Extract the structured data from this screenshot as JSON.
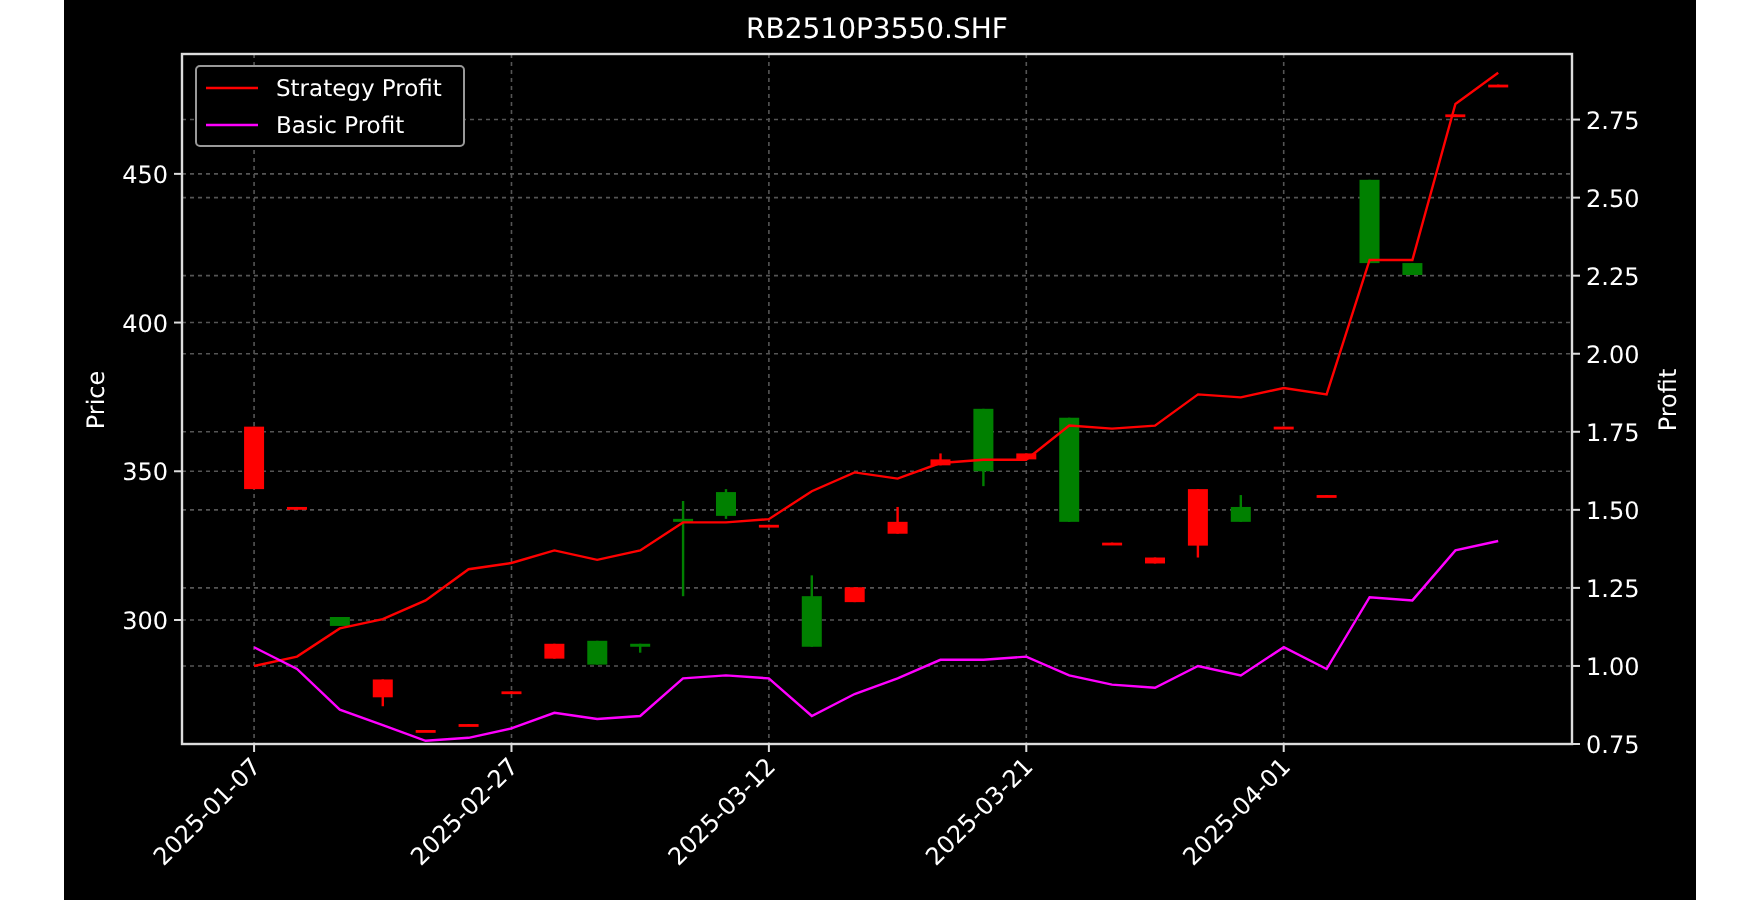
{
  "chart": {
    "chart_data": {
      "type": "line",
      "title": "RB2510P3550.SHF",
      "ylabel": "Price",
      "y2label": "Profit",
      "grid": true,
      "legend": true,
      "categories": [
        "2025-01-07",
        null,
        null,
        null,
        null,
        null,
        "2025-02-27",
        null,
        null,
        null,
        null,
        null,
        "2025-03-12",
        null,
        null,
        null,
        null,
        null,
        "2025-03-21",
        null,
        null,
        null,
        null,
        null,
        "2025-04-01",
        null,
        null,
        null,
        null,
        null
      ],
      "ylim": [
        258.3,
        490.3
      ],
      "y2lim": [
        0.75,
        2.96
      ],
      "yticks": [
        300,
        350,
        400,
        450
      ],
      "y2ticks": [
        {
          "value": 0.75,
          "label": "0.75"
        },
        {
          "value": 1,
          "label": "1.00"
        },
        {
          "value": 1.25,
          "label": "1.25"
        },
        {
          "value": 1.5,
          "label": "1.50"
        },
        {
          "value": 1.75,
          "label": "1.75"
        },
        {
          "value": 2,
          "label": "2.00"
        },
        {
          "value": 2.25,
          "label": "2.25"
        },
        {
          "value": 2.5,
          "label": "2.50"
        },
        {
          "value": 2.75,
          "label": "2.75"
        }
      ],
      "series": [
        {
          "type": "candlestick",
          "ohlc": [
            [
              365,
              365,
              344,
              344
            ],
            [
              338,
              338,
              338,
              338
            ],
            [
              298,
              301,
              298,
              301
            ],
            [
              280,
              280,
              271,
              274
            ],
            [
              263,
              263,
              263,
              263
            ],
            [
              265,
              265,
              265,
              265
            ],
            [
              276,
              276,
              276,
              276
            ],
            [
              292,
              292,
              287,
              287
            ],
            [
              285,
              293,
              285,
              293
            ],
            [
              291,
              292,
              289,
              292
            ],
            [
              333,
              340,
              308,
              334
            ],
            [
              335,
              344,
              334,
              343
            ],
            [
              332,
              332,
              332,
              332
            ],
            [
              291,
              315,
              291,
              308
            ],
            [
              311,
              311,
              306,
              306
            ],
            [
              333,
              338,
              329,
              329
            ],
            [
              354,
              356,
              352,
              352
            ],
            [
              350,
              371,
              345,
              371
            ],
            [
              356,
              356,
              354,
              354
            ],
            [
              333,
              368,
              333,
              368
            ],
            [
              326,
              326,
              326,
              326
            ],
            [
              321,
              321,
              319,
              319
            ],
            [
              344,
              344,
              321,
              325
            ],
            [
              333,
              342,
              333,
              338
            ],
            [
              365,
              365,
              365,
              365
            ],
            [
              342,
              342,
              342,
              342
            ],
            [
              420,
              448,
              420,
              448
            ],
            [
              416,
              420,
              416,
              420
            ],
            [
              470,
              470,
              470,
              470
            ],
            [
              480,
              480,
              480,
              480
            ]
          ]
        },
        {
          "name": "Strategy Profit",
          "color": "#ff0000",
          "axis": "y2",
          "values": [
            1.0,
            1.03,
            1.12,
            1.15,
            1.21,
            1.31,
            1.33,
            1.37,
            1.34,
            1.37,
            1.46,
            1.46,
            1.47,
            1.56,
            1.62,
            1.6,
            1.65,
            1.66,
            1.66,
            1.77,
            1.76,
            1.77,
            1.87,
            1.86,
            1.89,
            1.87,
            2.3,
            2.3,
            2.8,
            2.9
          ]
        },
        {
          "name": "Basic Profit",
          "color": "#ff00ff",
          "axis": "y2",
          "values": [
            1.06,
            0.99,
            0.86,
            0.81,
            0.76,
            0.77,
            0.8,
            0.85,
            0.83,
            0.84,
            0.96,
            0.97,
            0.96,
            0.84,
            0.91,
            0.96,
            1.02,
            1.02,
            1.03,
            0.97,
            0.94,
            0.93,
            1.0,
            0.97,
            1.06,
            0.99,
            1.22,
            1.21,
            1.37,
            1.4
          ]
        }
      ]
    }
  }
}
